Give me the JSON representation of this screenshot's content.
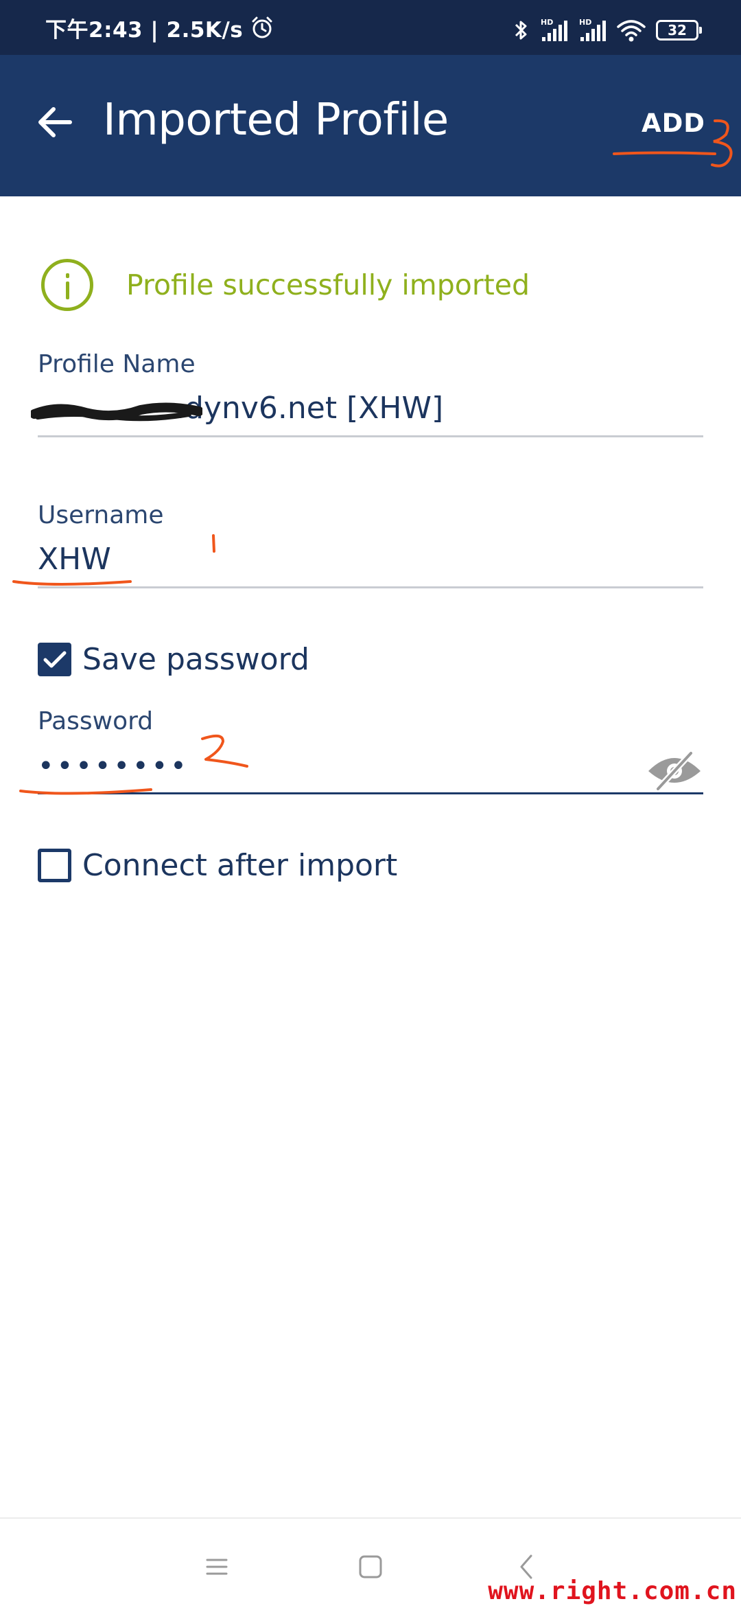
{
  "status_bar": {
    "time_speed": "下午2:43 | 2.5K/s",
    "icons": [
      "alarm-icon",
      "bluetooth-icon",
      "signal-hd-icon",
      "signal-hd-icon",
      "wifi-icon"
    ],
    "battery": "32"
  },
  "app_bar": {
    "title": "Imported Profile",
    "add_label": "ADD",
    "back_icon": "arrow-left-icon"
  },
  "banner": {
    "text": "Profile successfully imported",
    "icon": "info-circle-icon",
    "color": "#8fb01d"
  },
  "form": {
    "profile_name": {
      "label": "Profile Name",
      "value": ".dynv6.net [XHW]"
    },
    "username": {
      "label": "Username",
      "value": "XHW"
    },
    "save_password": {
      "label": "Save password",
      "checked": true
    },
    "password": {
      "label": "Password",
      "value": "••••••••",
      "icon": "eye-off-icon"
    },
    "connect_after_import": {
      "label": "Connect after import",
      "checked": false
    }
  },
  "annotations": [
    "1",
    "2",
    "3"
  ],
  "nav_bar": {
    "icons": [
      "menu-icon",
      "home-icon",
      "back-icon"
    ]
  },
  "watermark": "www.right.com.cn",
  "colors": {
    "app_bar": "#1c3968",
    "status_bar": "#16284b",
    "accent": "#8fb01d",
    "annotation": "#f0561c",
    "watermark": "#e0141e"
  }
}
